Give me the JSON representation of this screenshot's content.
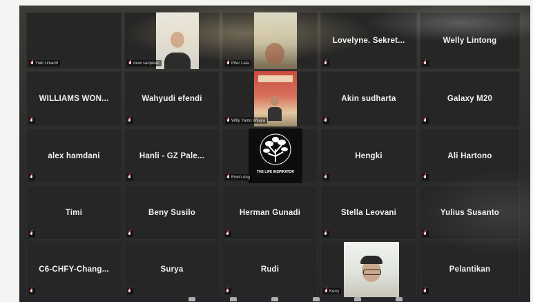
{
  "meeting": {
    "grid": [
      [
        {
          "name": "Yudi Limardi",
          "type": "name-only",
          "tile_text": "",
          "label": "Yudi Limardi"
        },
        {
          "name": "dewi saripwati",
          "type": "video",
          "video": "dewi",
          "label": "dewi saripwati"
        },
        {
          "name": "Piter Lala",
          "type": "video",
          "video": "piter",
          "label": "Piter Lala"
        },
        {
          "name": "Lovelyne. Sekret...",
          "type": "name",
          "tile_text": "Lovelyne. Sekret...",
          "label": ""
        },
        {
          "name": "Welly Lintong",
          "type": "name",
          "tile_text": "Welly Lintong",
          "label": ""
        }
      ],
      [
        {
          "name": "WILLIAMS WON...",
          "type": "name",
          "tile_text": "WILLIAMS WON...",
          "label": ""
        },
        {
          "name": "Wahyudi efendi",
          "type": "name",
          "tile_text": "Wahyudi efendi",
          "label": ""
        },
        {
          "name": "Willy Yanto Wijaya",
          "type": "video",
          "video": "willy",
          "label": "Willy Yanto Wijaya"
        },
        {
          "name": "Akin sudharta",
          "type": "name",
          "tile_text": "Akin sudharta",
          "label": ""
        },
        {
          "name": "Galaxy M20",
          "type": "name",
          "tile_text": "Galaxy M20",
          "label": ""
        }
      ],
      [
        {
          "name": "alex hamdani",
          "type": "name",
          "tile_text": "alex hamdani",
          "label": ""
        },
        {
          "name": "Hanli - GZ Pale...",
          "type": "name",
          "tile_text": "Hanli - GZ Pale...",
          "label": ""
        },
        {
          "name": "Erwin Ang",
          "type": "video",
          "video": "logo",
          "label": "Erwin Ang",
          "logo_text": "THE LIFE INSPIRATOR"
        },
        {
          "name": "Hengki",
          "type": "name",
          "tile_text": "Hengki",
          "label": ""
        },
        {
          "name": "Ali Hartono",
          "type": "name",
          "tile_text": "Ali Hartono",
          "label": ""
        }
      ],
      [
        {
          "name": "Timi",
          "type": "name",
          "tile_text": "Timi",
          "label": ""
        },
        {
          "name": "Beny Susilo",
          "type": "name",
          "tile_text": "Beny Susilo",
          "label": ""
        },
        {
          "name": "Herman Gunadi",
          "type": "name",
          "tile_text": "Herman Gunadi",
          "label": ""
        },
        {
          "name": "Stella Leovani",
          "type": "name",
          "tile_text": "Stella Leovani",
          "label": ""
        },
        {
          "name": "Yulius Susanto",
          "type": "name",
          "tile_text": "Yulius Susanto",
          "label": ""
        }
      ],
      [
        {
          "name": "C6-CHFY-Chang...",
          "type": "name",
          "tile_text": "C6-CHFY-Chang...",
          "label": ""
        },
        {
          "name": "Surya",
          "type": "name",
          "tile_text": "Surya",
          "label": ""
        },
        {
          "name": "Rudi",
          "type": "name",
          "tile_text": "Rudi",
          "label": ""
        },
        {
          "name": "Kerry",
          "type": "video",
          "video": "kerry",
          "label": "Kerry"
        },
        {
          "name": "Pelantikan",
          "type": "name",
          "tile_text": "Pelantikan",
          "label": ""
        }
      ]
    ],
    "toolbar_icons": [
      "unmute-icon",
      "participants-icon",
      "chat-icon",
      "share-screen-icon",
      "record-icon",
      "reactions-icon"
    ],
    "colors": {
      "tile_bg": "#262626",
      "text": "#f2f2f2",
      "muted_mic": "#e23b3b"
    }
  }
}
